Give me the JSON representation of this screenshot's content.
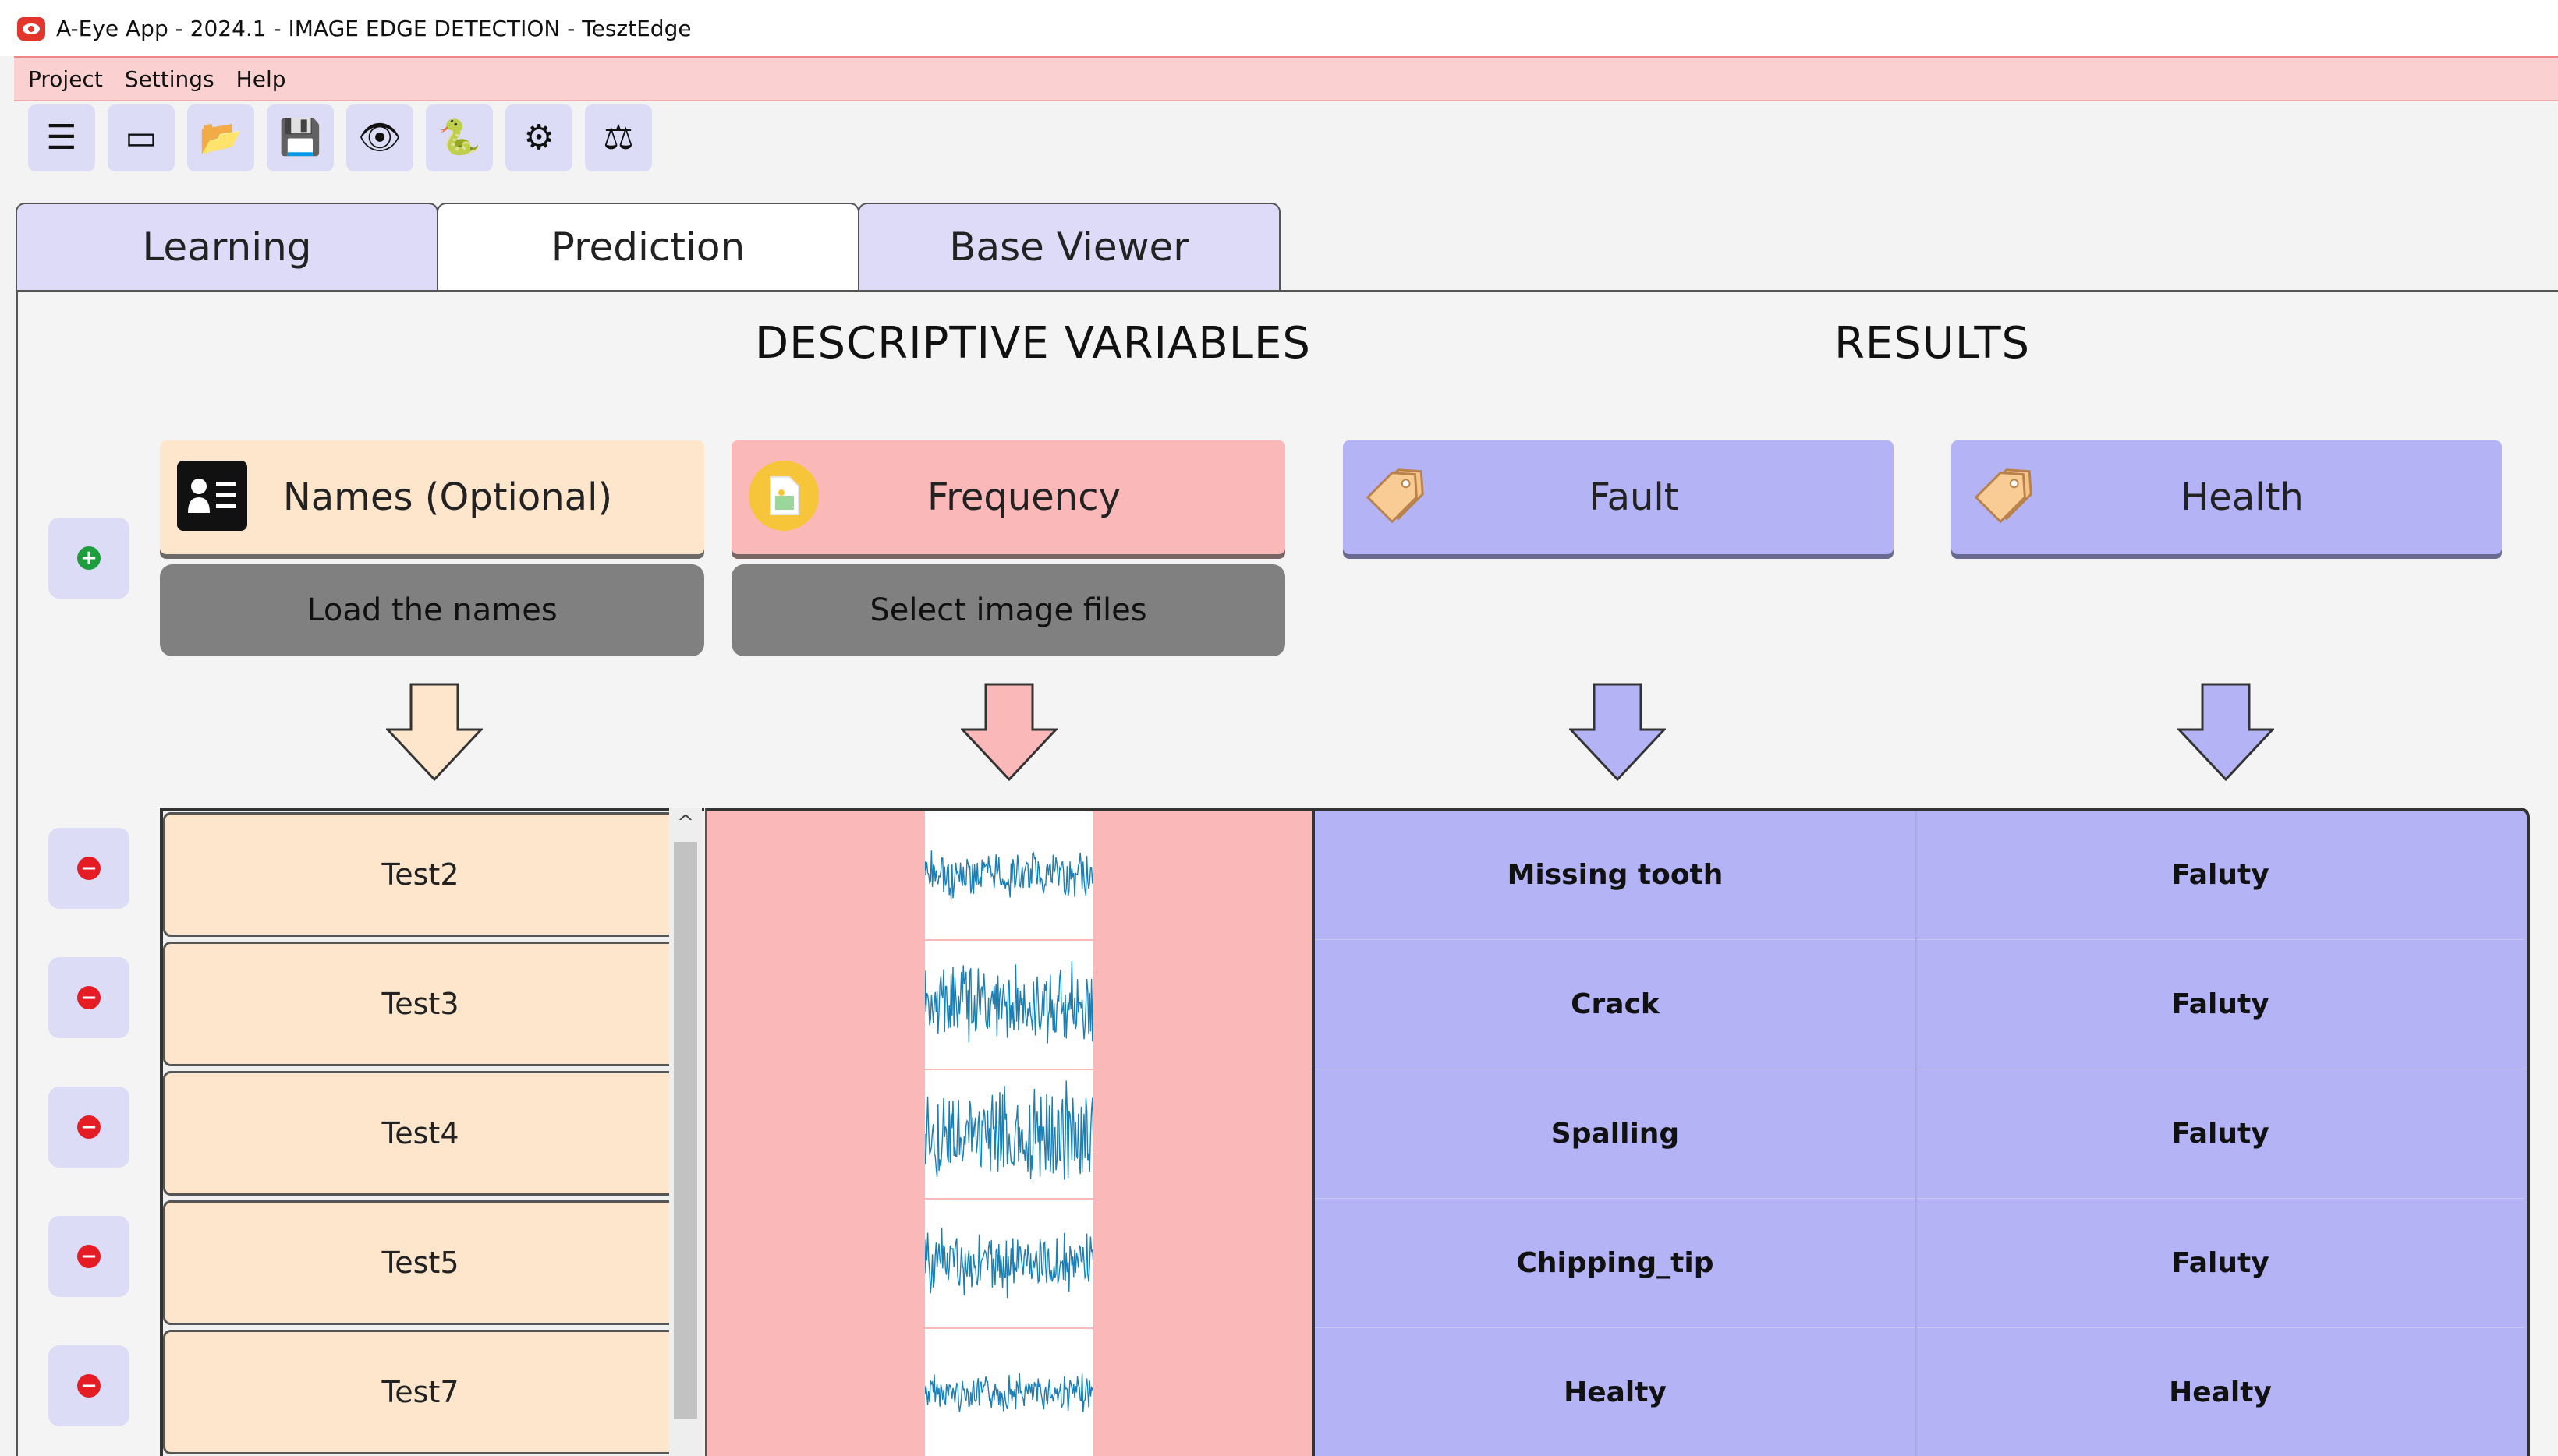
{
  "window": {
    "title": "A-Eye App - 2024.1 - IMAGE EDGE DETECTION - TesztEdge"
  },
  "menu": [
    "Project",
    "Settings",
    "Help"
  ],
  "toolbar": [
    {
      "icon": "list-icon",
      "glyph": "☰"
    },
    {
      "icon": "folder-icon",
      "glyph": "▭"
    },
    {
      "icon": "open-folder-icon",
      "glyph": "📂"
    },
    {
      "icon": "save-icon",
      "glyph": "💾"
    },
    {
      "icon": "eye-icon",
      "glyph": "👁"
    },
    {
      "icon": "python-icon",
      "glyph": "🐍"
    },
    {
      "icon": "gear-icon",
      "glyph": "⚙"
    },
    {
      "icon": "balance-icon",
      "glyph": "⚖"
    }
  ],
  "tabs": [
    {
      "label": "Learning",
      "active": false
    },
    {
      "label": "Prediction",
      "active": true
    },
    {
      "label": "Base Viewer",
      "active": false
    }
  ],
  "sections": {
    "descriptive": "DESCRIPTIVE VARIABLES",
    "results": "RESULTS"
  },
  "variables": {
    "names": {
      "label": "Names (Optional)",
      "button": "Load the names"
    },
    "frequency": {
      "label": "Frequency",
      "button": "Select image files"
    },
    "fault": {
      "label": "Fault"
    },
    "health": {
      "label": "Health"
    }
  },
  "rows": [
    {
      "name": "Test2",
      "fault": "Missing tooth",
      "health": "Faluty",
      "amplitude": 0.45
    },
    {
      "name": "Test3",
      "fault": "Crack",
      "health": "Faluty",
      "amplitude": 0.75
    },
    {
      "name": "Test4",
      "fault": "Spalling",
      "health": "Faluty",
      "amplitude": 0.9
    },
    {
      "name": "Test5",
      "fault": "Chipping_tip",
      "health": "Faluty",
      "amplitude": 0.6
    },
    {
      "name": "Test7",
      "fault": "Healty",
      "health": "Healty",
      "amplitude": 0.35
    }
  ],
  "colors": {
    "names": "#fde6cb",
    "frequency": "#fbb8b8",
    "results": "#b3b3f6",
    "wave": "#1a7fb5",
    "menu": "#fbd0d0"
  }
}
